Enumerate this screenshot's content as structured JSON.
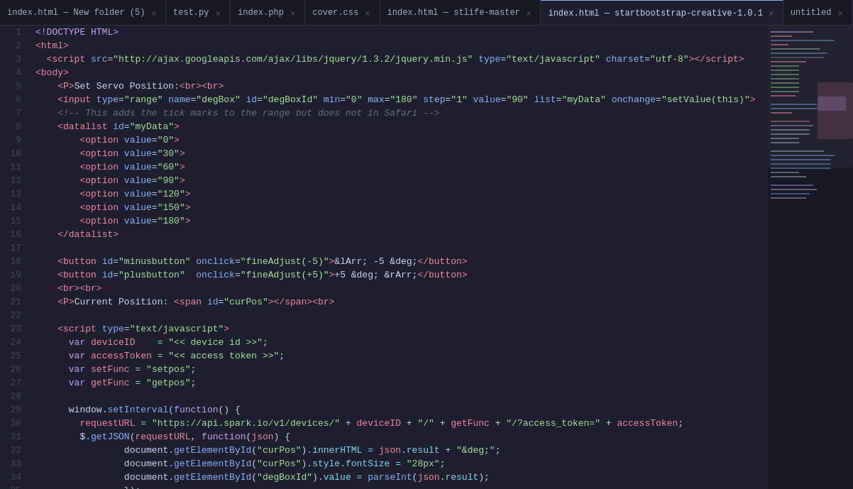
{
  "tabs": [
    {
      "label": "index.html — New folder (5)",
      "active": false,
      "closable": true
    },
    {
      "label": "test.py",
      "active": false,
      "closable": true
    },
    {
      "label": "index.php",
      "active": false,
      "closable": true
    },
    {
      "label": "cover.css",
      "active": false,
      "closable": true
    },
    {
      "label": "index.html — stlife-master",
      "active": false,
      "closable": true
    },
    {
      "label": "index.html — startbootstrap-creative-1.0.1",
      "active": true,
      "closable": true
    },
    {
      "label": "untitled",
      "active": false,
      "closable": true
    }
  ],
  "active_tab_index": 5,
  "editor": {
    "language": "html",
    "filename": "index.html"
  }
}
